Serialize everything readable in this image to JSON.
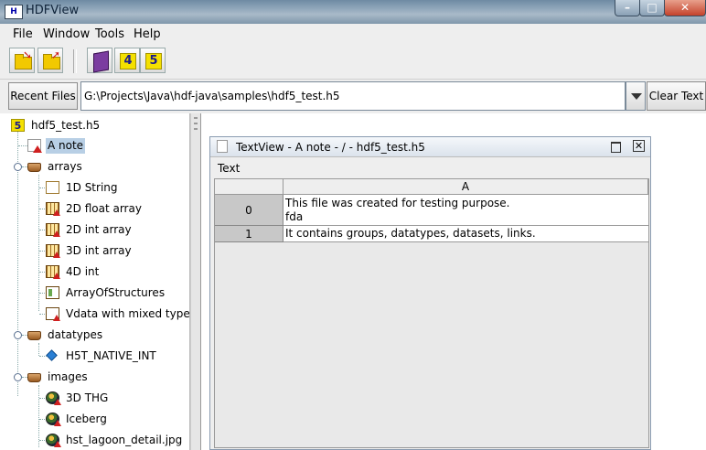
{
  "window": {
    "title": "HDFView",
    "app_icon": "hdf-logo-icon",
    "controls": [
      "minimize",
      "maximize",
      "close"
    ]
  },
  "menu": [
    {
      "label": "File"
    },
    {
      "label": "Window"
    },
    {
      "label": "Tools"
    },
    {
      "label": "Help"
    }
  ],
  "toolbar": {
    "buttons": [
      {
        "icon": "open-folder-icon"
      },
      {
        "icon": "close-folder-icon"
      },
      {
        "icon": "users-guide-book-icon"
      },
      {
        "icon": "hdf4-library-icon",
        "label": "4"
      },
      {
        "icon": "hdf5-library-icon",
        "label": "5"
      }
    ]
  },
  "recent": {
    "button_label": "Recent Files",
    "path": "G:\\Projects\\Java\\hdf-java\\samples\\hdf5_test.h5",
    "clear_label": "Clear Text"
  },
  "tree": {
    "root": {
      "label": "hdf5_test.h5",
      "icon": "hdf5-file-icon"
    },
    "nodes": [
      {
        "label": "A note",
        "icon": "text-note-icon",
        "selected": true
      },
      {
        "label": "arrays",
        "icon": "group-folder-icon"
      },
      {
        "label": "1D String",
        "icon": "string-dataset-icon"
      },
      {
        "label": "2D float array",
        "icon": "dataset-icon"
      },
      {
        "label": "2D int array",
        "icon": "dataset-icon"
      },
      {
        "label": "3D int array",
        "icon": "dataset-icon"
      },
      {
        "label": "4D int",
        "icon": "dataset-icon"
      },
      {
        "label": "ArrayOfStructures",
        "icon": "compound-dataset-icon"
      },
      {
        "label": "Vdata with mixed types",
        "icon": "vdata-icon"
      },
      {
        "label": "datatypes",
        "icon": "group-folder-icon"
      },
      {
        "label": "H5T_NATIVE_INT",
        "icon": "datatype-icon"
      },
      {
        "label": "images",
        "icon": "group-folder-icon"
      },
      {
        "label": "3D THG",
        "icon": "image-icon"
      },
      {
        "label": "Iceberg",
        "icon": "image-icon"
      },
      {
        "label": "hst_lagoon_detail.jpg",
        "icon": "image-icon"
      }
    ]
  },
  "textview": {
    "title": "TextView  -  A note  -  /  -  hdf5_test.h5",
    "menu_label": "Text",
    "column_header": "A",
    "rows": [
      {
        "index": "0",
        "line1": "This file was created for testing purpose.",
        "line2": "fda"
      },
      {
        "index": "1",
        "line1": "It contains groups, datatypes, datasets, links.",
        "line2": ""
      }
    ]
  }
}
